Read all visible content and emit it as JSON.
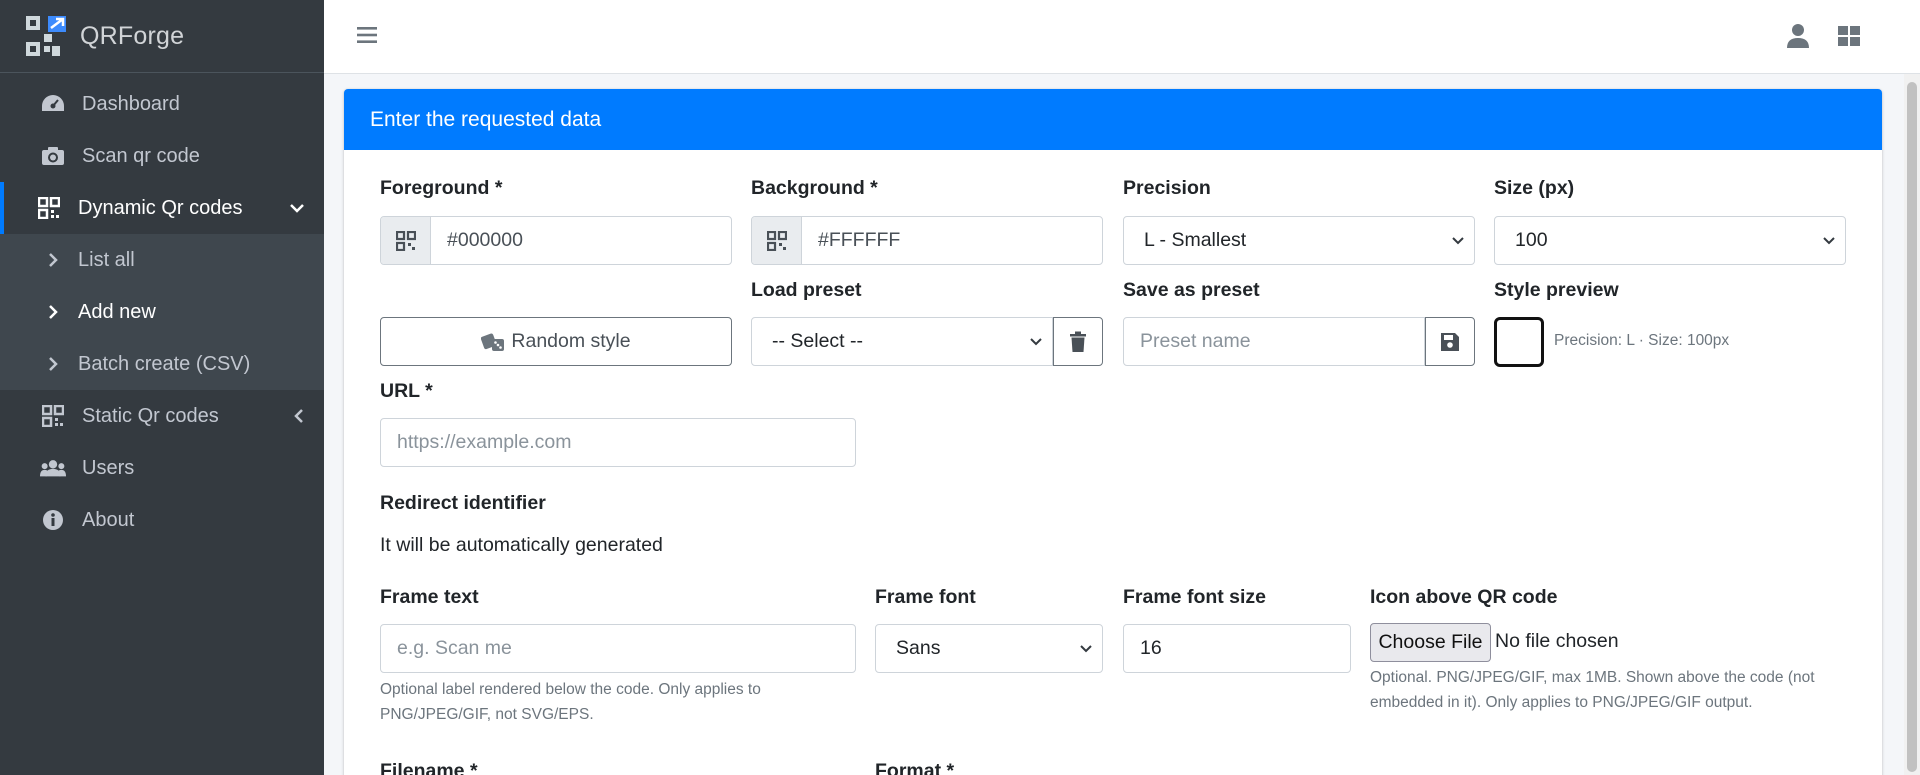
{
  "app": {
    "name": "QRForge"
  },
  "sidebar": {
    "items": [
      {
        "label": "Dashboard"
      },
      {
        "label": "Scan qr code"
      },
      {
        "label": "Dynamic Qr codes"
      },
      {
        "label": "List all"
      },
      {
        "label": "Add new"
      },
      {
        "label": "Batch create (CSV)"
      },
      {
        "label": "Static Qr codes"
      },
      {
        "label": "Users"
      },
      {
        "label": "About"
      }
    ]
  },
  "card": {
    "title": "Enter the requested data"
  },
  "form": {
    "foreground": {
      "label": "Foreground *",
      "value": "#000000"
    },
    "background": {
      "label": "Background *",
      "value": "#FFFFFF"
    },
    "precision": {
      "label": "Precision",
      "value": "L - Smallest"
    },
    "size": {
      "label": "Size (px)",
      "value": "100"
    },
    "random_style": {
      "label": "Random style"
    },
    "load_preset": {
      "label": "Load preset",
      "value": "-- Select --"
    },
    "save_preset": {
      "label": "Save as preset",
      "placeholder": "Preset name"
    },
    "style_preview": {
      "label": "Style preview",
      "caption": "Precision: L · Size: 100px"
    },
    "url": {
      "label": "URL *",
      "placeholder": "https://example.com"
    },
    "redirect": {
      "label": "Redirect identifier",
      "text": "It will be automatically generated"
    },
    "frame_text": {
      "label": "Frame text",
      "placeholder": "e.g. Scan me",
      "help_1": "Optional label rendered below the code. Only applies to",
      "help_2": "PNG/JPEG/GIF, not SVG/EPS."
    },
    "frame_font": {
      "label": "Frame font",
      "value": "Sans"
    },
    "frame_font_size": {
      "label": "Frame font size",
      "value": "16"
    },
    "icon": {
      "label": "Icon above QR code",
      "button": "Choose File",
      "status": "No file chosen",
      "help_1": "Optional. PNG/JPEG/GIF, max 1MB. Shown above the code (not",
      "help_2": "embedded in it). Only applies to PNG/JPEG/GIF output."
    },
    "filename": {
      "label": "Filename *"
    },
    "format": {
      "label": "Format *"
    }
  },
  "colors": {
    "accent": "#007bff",
    "sidebar_bg": "#343a40",
    "submenu_bg": "#3f474e"
  }
}
